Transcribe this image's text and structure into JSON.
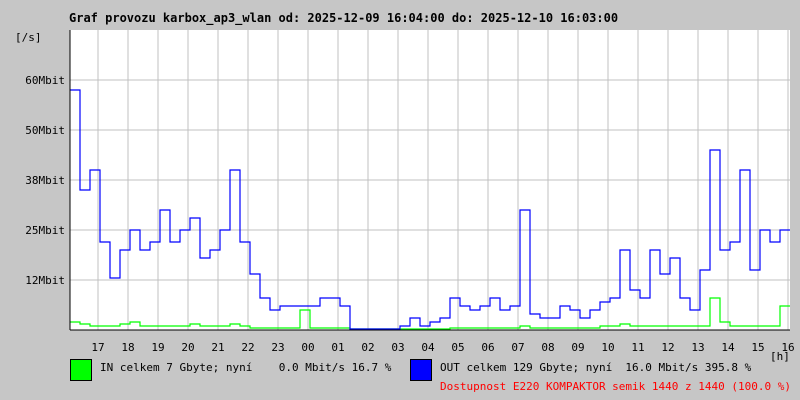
{
  "chart_data": {
    "type": "line",
    "title": "Graf provozu karbox_ap3_wlan od: 2025-12-09 16:04:00 do: 2025-12-10 16:03:00",
    "ylabel": "[/s]",
    "xlabel": "[h]",
    "ylim": [
      0,
      75
    ],
    "y_unit": "Mbit",
    "y_ticks": [
      {
        "v": 12.5,
        "label": "12Mbit"
      },
      {
        "v": 25,
        "label": "25Mbit"
      },
      {
        "v": 37.5,
        "label": "38Mbit"
      },
      {
        "v": 50,
        "label": "50Mbit"
      },
      {
        "v": 62.5,
        "label": "60Mbit"
      }
    ],
    "x_tick_labels": [
      "17",
      "18",
      "19",
      "20",
      "21",
      "22",
      "23",
      "00",
      "01",
      "02",
      "03",
      "04",
      "05",
      "06",
      "07",
      "08",
      "09",
      "10",
      "11",
      "12",
      "13",
      "14",
      "15",
      "16"
    ],
    "x_sample_interval_minutes": 20,
    "grid": true,
    "series": [
      {
        "name": "OUT",
        "color": "#0000ff",
        "values": [
          60,
          35,
          40,
          22,
          13,
          20,
          25,
          20,
          22,
          30,
          22,
          25,
          28,
          18,
          20,
          25,
          40,
          22,
          14,
          8,
          5,
          6,
          6,
          6,
          6,
          8,
          8,
          6,
          0,
          0,
          0,
          0,
          0,
          1,
          3,
          1,
          2,
          3,
          8,
          6,
          5,
          6,
          8,
          5,
          6,
          30,
          4,
          3,
          3,
          6,
          5,
          3,
          5,
          7,
          8,
          20,
          10,
          8,
          20,
          14,
          18,
          8,
          5,
          15,
          45,
          20,
          22,
          40,
          15,
          25,
          22,
          25
        ]
      },
      {
        "name": "IN",
        "color": "#00ff00",
        "values": [
          2,
          1.5,
          1,
          1,
          1,
          1.5,
          2,
          1,
          1,
          1,
          1,
          1,
          1.5,
          1,
          1,
          1,
          1.5,
          1,
          0.5,
          0.5,
          0.5,
          0.5,
          0.5,
          5,
          0.5,
          0.5,
          0.5,
          0.5,
          0,
          0,
          0,
          0,
          0,
          0,
          0,
          0,
          0,
          0,
          0.5,
          0.5,
          0.5,
          0.5,
          0.5,
          0.5,
          0.5,
          1,
          0.5,
          0.5,
          0.5,
          0.5,
          0.5,
          0.5,
          0.5,
          1,
          1,
          1.5,
          1,
          1,
          1,
          1,
          1,
          1,
          1,
          1,
          8,
          2,
          1,
          1,
          1,
          1,
          1,
          6
        ]
      }
    ]
  },
  "legend": {
    "in_text": "IN celkem 7 Gbyte; nyní    0.0 Mbit/s 16.7 %",
    "out_text": "OUT celkem 129 Gbyte; nyní  16.0 Mbit/s 395.8 %",
    "availability": "Dostupnost E220 KOMPAKTOR semik 1440 z 1440 (100.0 %)",
    "in_color": "#00ff00",
    "out_color": "#0000ff",
    "availability_color": "#ff0000"
  }
}
